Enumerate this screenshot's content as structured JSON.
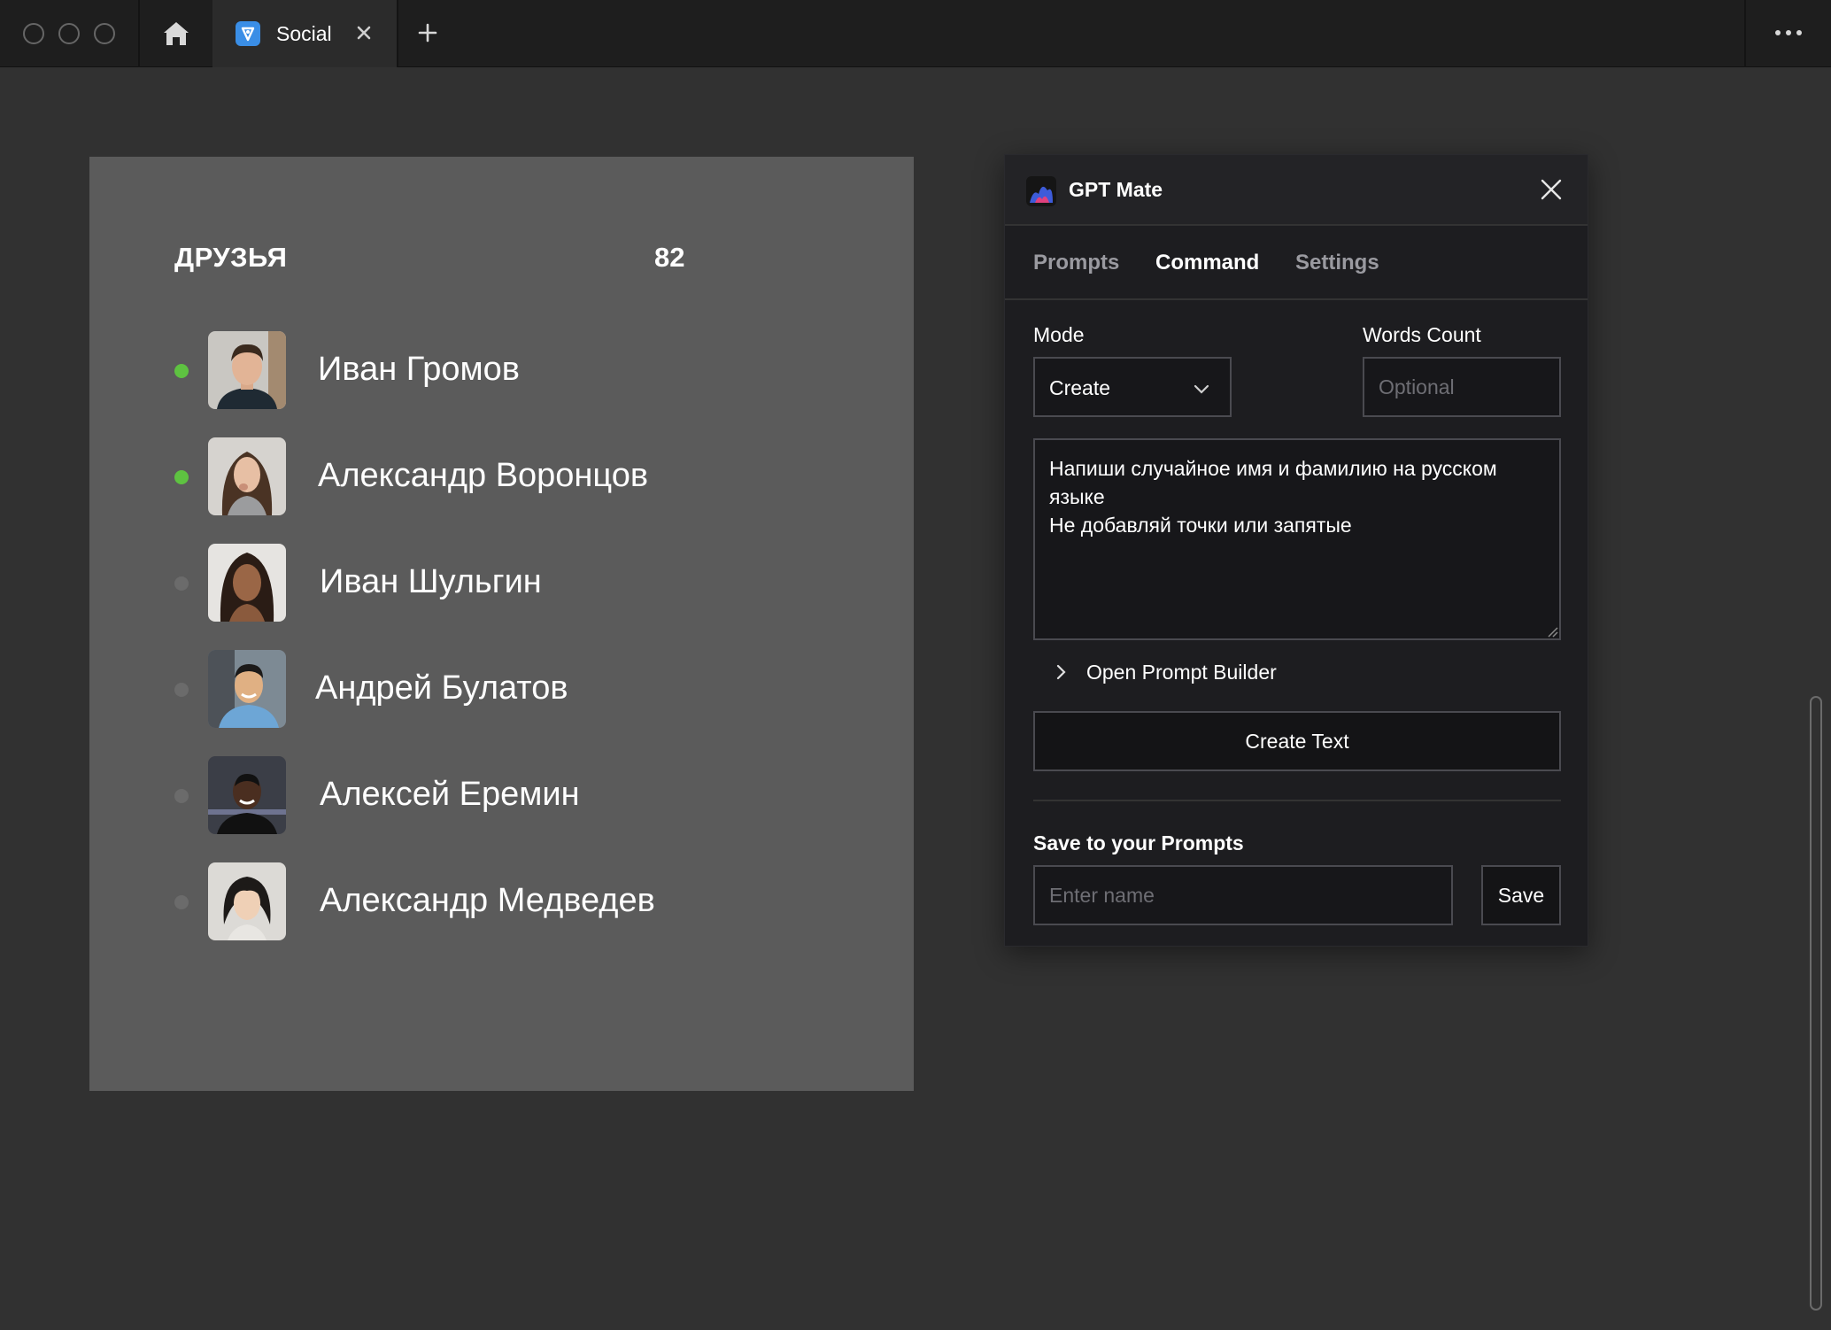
{
  "browser": {
    "tab_label": "Social"
  },
  "friends": {
    "title": "ДРУЗЬЯ",
    "count": "82",
    "items": [
      {
        "name": "Иван Громов",
        "online": true
      },
      {
        "name": "Александр Воронцов",
        "online": true
      },
      {
        "name": "Иван Шульгин",
        "online": false
      },
      {
        "name": "Андрей Булатов",
        "online": false
      },
      {
        "name": "Алексей Еремин",
        "online": false
      },
      {
        "name": "Александр Медведев",
        "online": false
      }
    ]
  },
  "gpt_mate": {
    "title": "GPT Mate",
    "tabs": [
      "Prompts",
      "Command",
      "Settings"
    ],
    "active_tab": "Command",
    "mode_label": "Mode",
    "mode_value": "Create",
    "words_count_label": "Words Count",
    "words_count_placeholder": "Optional",
    "prompt_text": "Напиши случайное имя и фамилию на русском языке\nНе добавляй точки или запятые",
    "builder_label": "Open Prompt Builder",
    "create_button": "Create Text",
    "save_heading": "Save to your Prompts",
    "name_placeholder": "Enter name",
    "save_button": "Save"
  },
  "colors": {
    "online": "#5ec241",
    "offline": "#6b6b6b",
    "panel_bg": "#1d1d20",
    "friends_bg": "#5b5b5b"
  }
}
